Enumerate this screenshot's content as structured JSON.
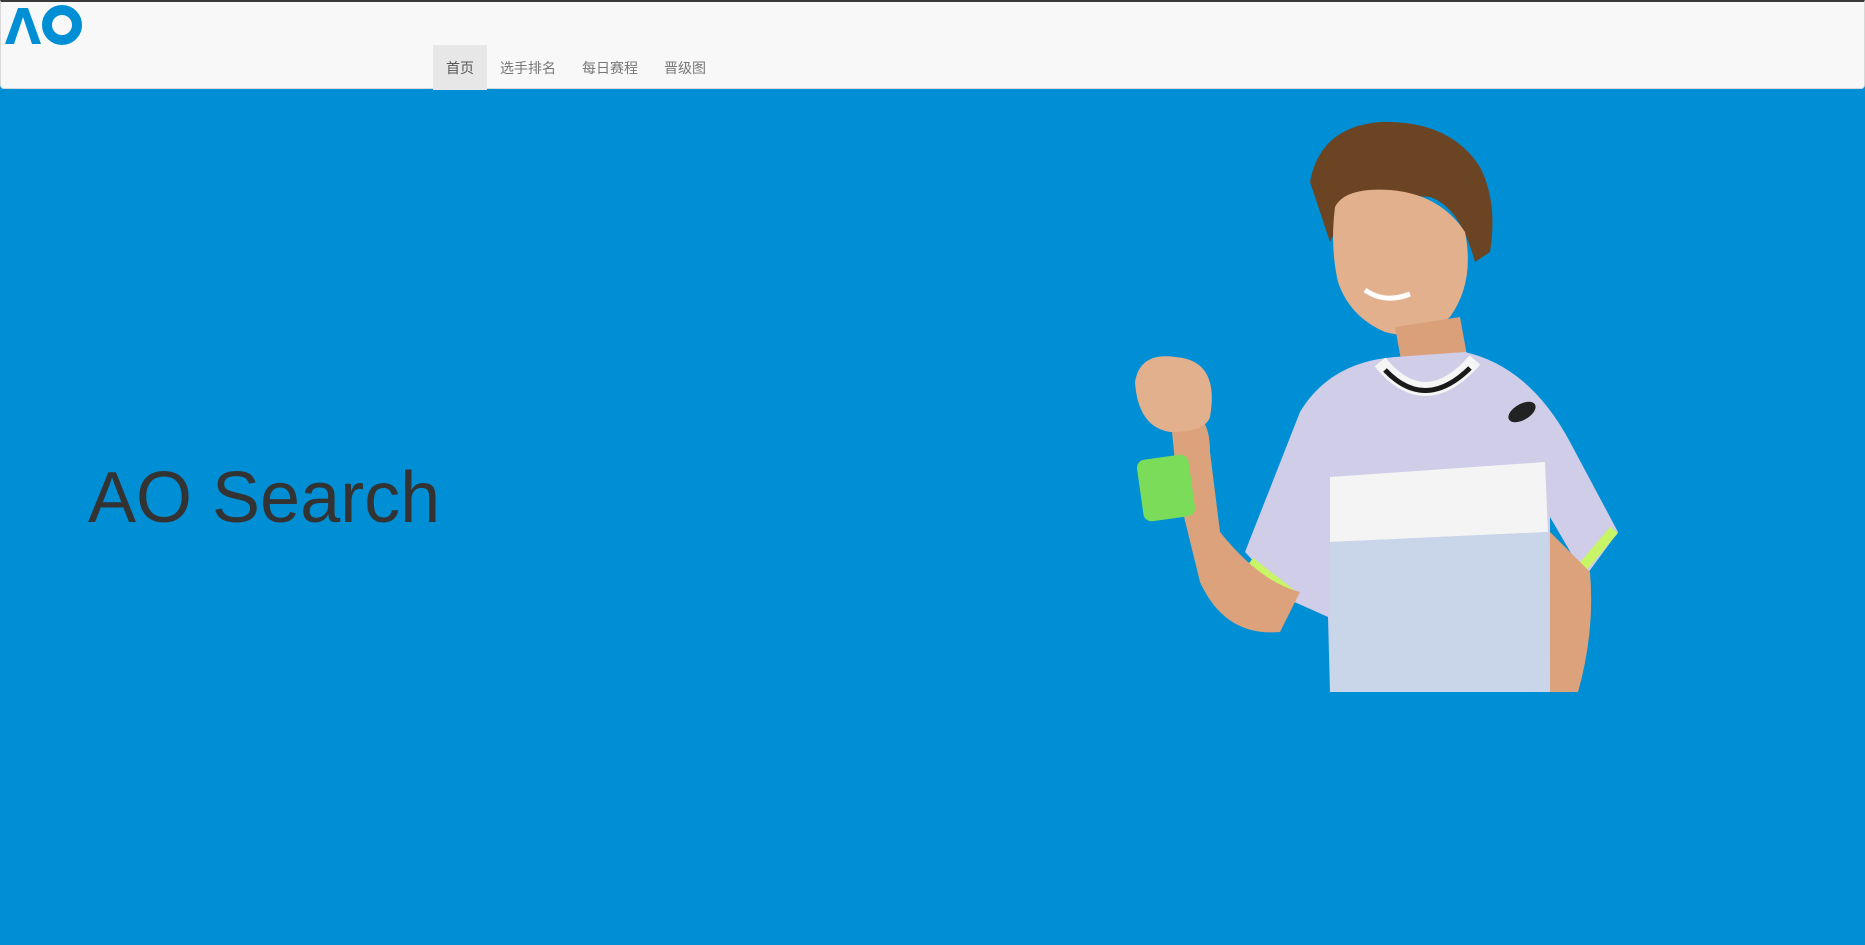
{
  "brand": {
    "logo_text": "AO",
    "accent": "#008fd5"
  },
  "nav": {
    "items": [
      {
        "label": "首页",
        "active": true
      },
      {
        "label": "选手排名",
        "active": false
      },
      {
        "label": "每日赛程",
        "active": false
      },
      {
        "label": "晋级图",
        "active": false
      }
    ]
  },
  "hero": {
    "title": "AO Search",
    "image_icon": "tennis-player-photo",
    "background": "#008fd5"
  }
}
